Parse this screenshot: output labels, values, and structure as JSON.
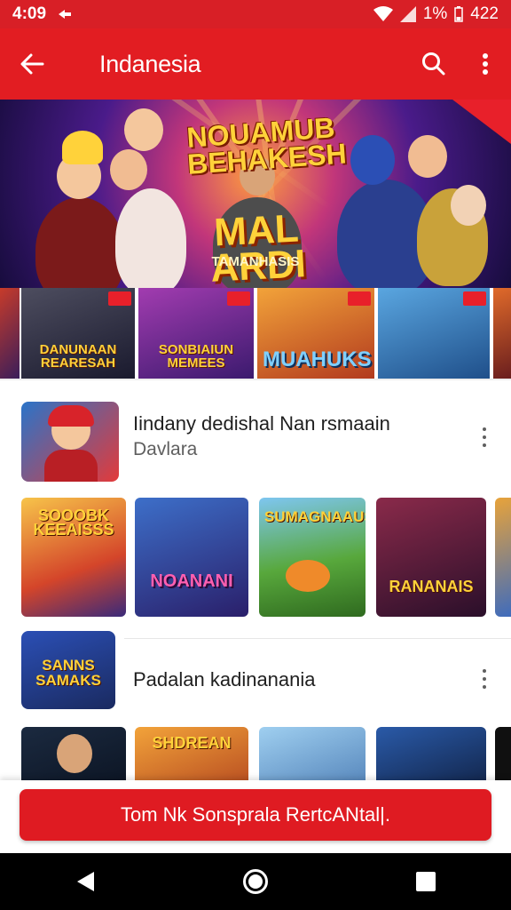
{
  "status_bar": {
    "time": "4:09",
    "battery_percent": "1%",
    "battery_level": "422",
    "icons": [
      "cast-icon",
      "wifi-icon",
      "signal-icon",
      "battery-icon"
    ]
  },
  "app_bar": {
    "title": "Indanesia",
    "icons": [
      "back-arrow-icon",
      "search-icon",
      "more-vert-icon"
    ]
  },
  "hero": {
    "title_top": "NOUAMUB BEHAKESH",
    "title_main": "MAL ARDI",
    "subtitle": "TAMANHASIS"
  },
  "strip": {
    "tiles": [
      {
        "title": "DANUNAAN REARESAH",
        "bg": "#2a2a44"
      },
      {
        "title": "SONBIAIUN MEMEES",
        "bg": "#7a2f8a"
      },
      {
        "title": "MUAHUKS",
        "bg": "#d8572a"
      },
      {
        "title": "",
        "bg": "#3d86c9"
      }
    ]
  },
  "section1": {
    "heading": "Iindany dedishal Nan rsmaain",
    "subheading": "Davlara",
    "cards": [
      {
        "title": "SOOOBK KEEAISSS",
        "bg": "#f1a533"
      },
      {
        "title": "NOANANI",
        "bg": "#2c3f8f"
      },
      {
        "title": "SUMAGNAAUS",
        "bg": "#4c9a3b"
      },
      {
        "title": "RANANAIS",
        "bg": "#5b1f3b"
      }
    ]
  },
  "section2": {
    "heading": "Padalan kadinanania",
    "thumb_title": "SANNS SAMAKS",
    "cards": [
      {
        "title": "",
        "bg": "#1b2a40"
      },
      {
        "title": "SHDREAN",
        "bg": "#e07a2a"
      },
      {
        "title": "",
        "bg": "#4d7db5"
      },
      {
        "title": "",
        "bg": "#1d3660"
      }
    ]
  },
  "cta": {
    "label": "Tom Nk Sonsprala RertcANtal|."
  },
  "colors": {
    "brand_red": "#e21d22",
    "status_red": "#d81f26"
  }
}
